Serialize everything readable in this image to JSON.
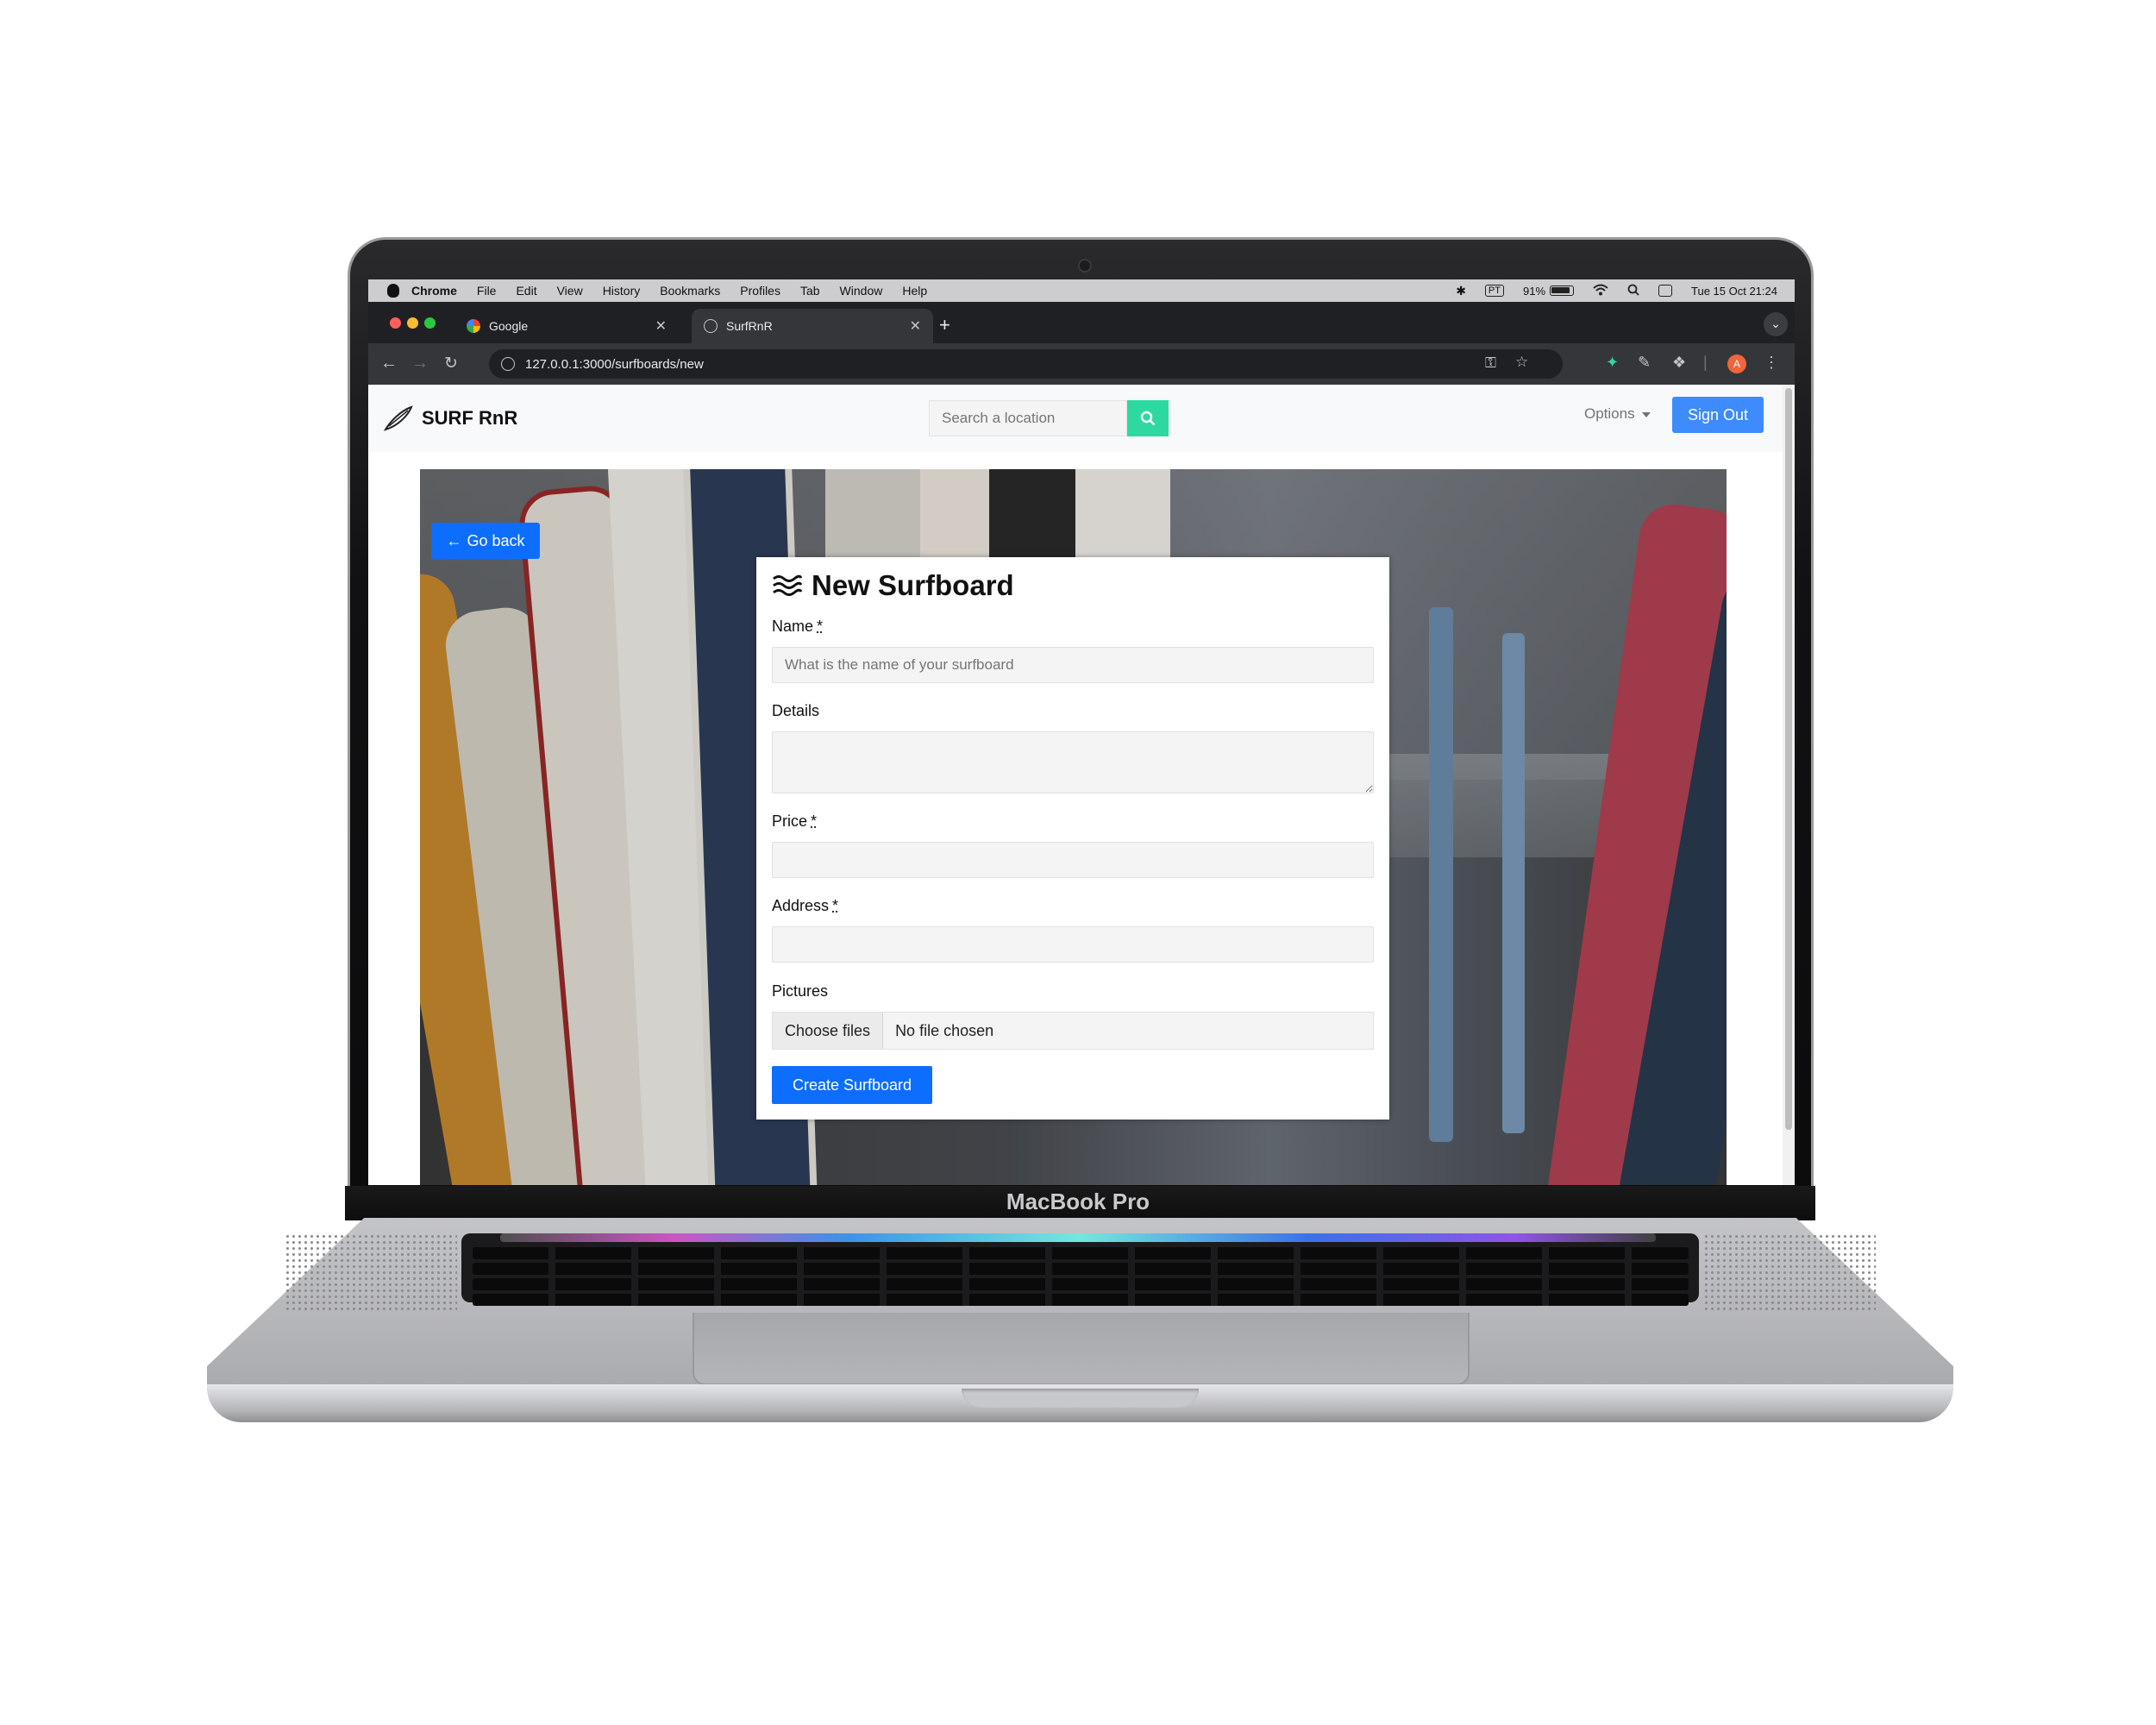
{
  "device": {
    "label": "MacBook Pro"
  },
  "mac_menubar": {
    "app": "Chrome",
    "menus": [
      "File",
      "Edit",
      "View",
      "History",
      "Bookmarks",
      "Profiles",
      "Tab",
      "Window",
      "Help"
    ],
    "input_source": "PT",
    "battery": "91%",
    "datetime": "Tue 15 Oct  21:24"
  },
  "browser": {
    "tabs": [
      {
        "title": "Google",
        "active": false
      },
      {
        "title": "SurfRnR",
        "active": true
      }
    ],
    "url": "127.0.0.1:3000/surfboards/new",
    "profile_initial": "A"
  },
  "navbar": {
    "brand": "SURF RnR",
    "search_placeholder": "Search a location",
    "options_label": "Options",
    "signout_label": "Sign Out"
  },
  "page": {
    "goback_label": "Go back",
    "form": {
      "title": "New Surfboard",
      "name_label": "Name",
      "name_placeholder": "What is the name of your surfboard",
      "details_label": "Details",
      "price_label": "Price",
      "address_label": "Address",
      "pictures_label": "Pictures",
      "choose_files": "Choose files",
      "no_file": "No file chosen",
      "required_mark": "*",
      "submit_label": "Create Surfboard"
    }
  },
  "colors": {
    "primary": "#0d6efd",
    "signout": "#3d8bfd",
    "search_button": "#2ed8a1",
    "profile_avatar": "#f0663a"
  }
}
